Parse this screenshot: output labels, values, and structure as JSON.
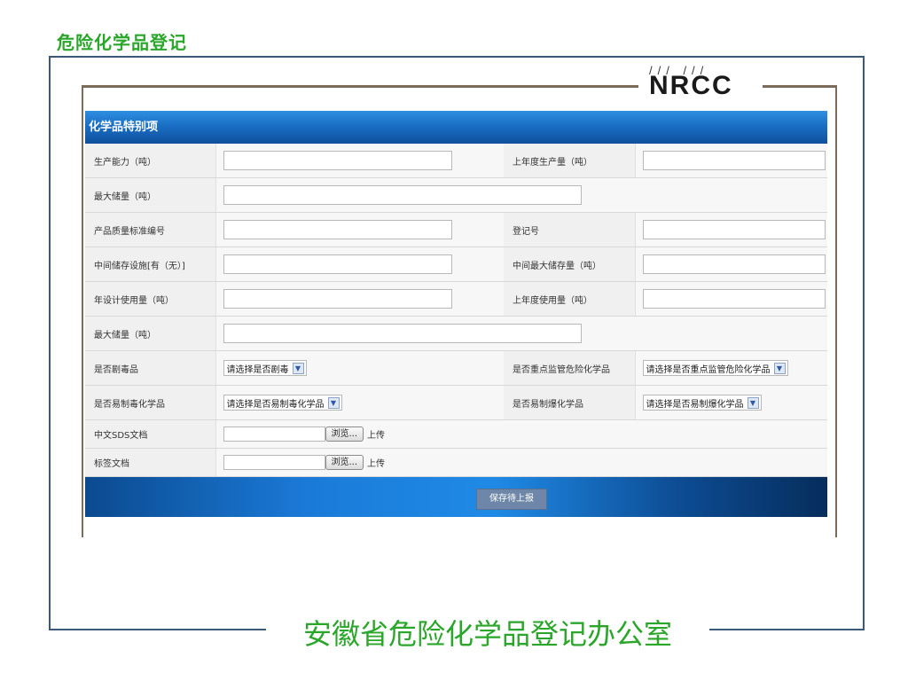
{
  "page_title": "危险化学品登记",
  "brand": {
    "logo_text": "NRCC",
    "logo_mark": "/// ///"
  },
  "footer_org": "安徽省危险化学品登记办公室",
  "section": {
    "title": "化学品特别项"
  },
  "rows": {
    "production_capacity": "生产能力（吨）",
    "last_year_production": "上年度生产量（吨）",
    "max_storage_1": "最大储量（吨）",
    "quality_standard_no": "产品质量标准编号",
    "registration_no": "登记号",
    "intermediate_storage": "中间储存设施[有（无）]",
    "intermediate_max_storage": "中间最大储存量（吨）",
    "annual_design_usage": "年设计使用量（吨）",
    "last_year_usage": "上年度使用量（吨）",
    "max_storage_2": "最大储量（吨）",
    "highly_toxic": "是否剧毒品",
    "key_supervised": "是否重点监管危险化学品",
    "precursor_drug": "是否易制毒化学品",
    "precursor_explosive": "是否易制爆化学品",
    "sds_document": "中文SDS文档",
    "label_document": "标签文档"
  },
  "selects": {
    "highly_toxic": "请选择是否剧毒",
    "key_supervised": "请选择是否重点监管危险化学品",
    "precursor_drug": "请选择是否易制毒化学品",
    "precursor_explosive": "请选择是否易制爆化学品"
  },
  "file": {
    "browse_label": "浏览...",
    "upload_label": "上传"
  },
  "actions": {
    "save_label": "保存待上报"
  }
}
